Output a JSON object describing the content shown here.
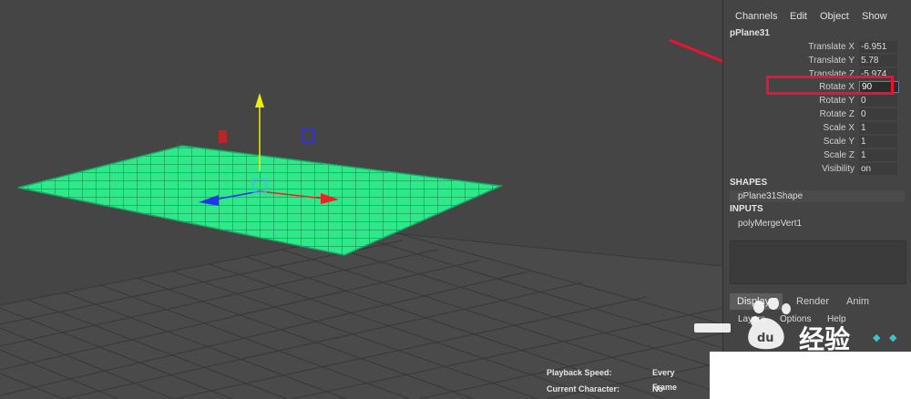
{
  "channel_box": {
    "menu": [
      "Channels",
      "Edit",
      "Object",
      "Show"
    ],
    "object_name": "pPlane31",
    "attributes": [
      {
        "label": "Translate X",
        "value": "-6.951"
      },
      {
        "label": "Translate Y",
        "value": "5.78"
      },
      {
        "label": "Translate Z",
        "value": "-5.974"
      },
      {
        "label": "Rotate X",
        "value": "90"
      },
      {
        "label": "Rotate Y",
        "value": "0"
      },
      {
        "label": "Rotate Z",
        "value": "0"
      },
      {
        "label": "Scale X",
        "value": "1"
      },
      {
        "label": "Scale Y",
        "value": "1"
      },
      {
        "label": "Scale Z",
        "value": "1"
      },
      {
        "label": "Visibility",
        "value": "on"
      }
    ],
    "shapes_header": "SHAPES",
    "shape_node": "pPlane31Shape",
    "inputs_header": "INPUTS",
    "input_node": "polyMergeVert1"
  },
  "layer_editor": {
    "tabs": [
      "Display",
      "Render",
      "Anim"
    ],
    "active_tab": "Display",
    "menu": [
      "Layers",
      "Options",
      "Help"
    ],
    "tool_icons": [
      "new-layer-icon",
      "new-layer-selected-icon"
    ]
  },
  "status": {
    "playback_speed_label": "Playback Speed:",
    "playback_speed_value": "Every Frame",
    "current_character_label": "Current Character:",
    "current_character_value": "No Character"
  },
  "watermark": {
    "brand_text": "经验",
    "logo": "baidu-paw-logo"
  },
  "colors": {
    "plane_fill": "#2ee88a",
    "annotation_red": "#ee1133",
    "axis_y": "#f0f000",
    "axis_x": "#ee2222",
    "axis_z": "#2233ee"
  }
}
